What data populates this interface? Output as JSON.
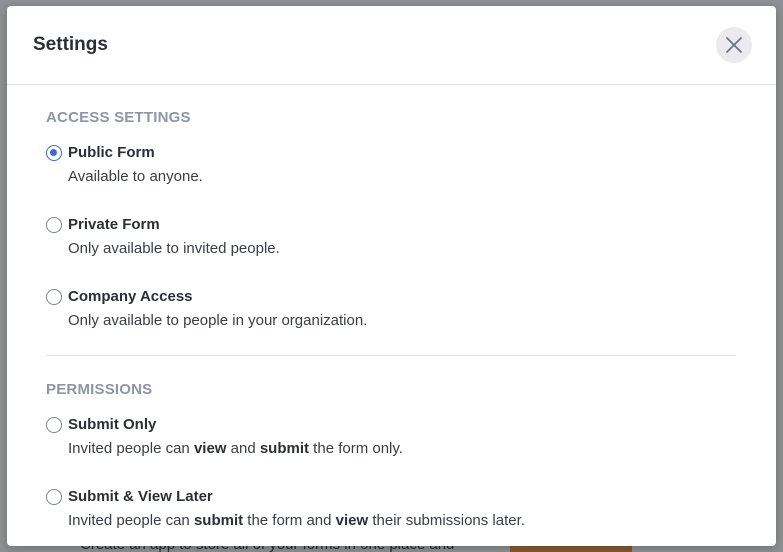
{
  "background": {
    "text": "Create an app to store all of your forms in one place and"
  },
  "dialog": {
    "title": "Settings",
    "close_icon": "close-icon"
  },
  "access": {
    "label": "ACCESS SETTINGS",
    "options": [
      {
        "title": "Public Form",
        "desc": "Available to anyone.",
        "selected": true
      },
      {
        "title": "Private Form",
        "desc": "Only available to invited people.",
        "selected": false
      },
      {
        "title": "Company Access",
        "desc": "Only available to people in your organization.",
        "selected": false
      }
    ]
  },
  "permissions": {
    "label": "PERMISSIONS",
    "options": [
      {
        "title": "Submit Only",
        "desc": {
          "p1": "Invited people can ",
          "b1": "view",
          "p2": " and ",
          "b2": "submit",
          "p3": " the form only."
        },
        "selected": false
      },
      {
        "title": "Submit & View Later",
        "desc": {
          "p1": "Invited people can ",
          "b1": "submit",
          "p2": " the form and ",
          "b2": "view",
          "p3": " their submissions later."
        },
        "selected": false
      }
    ]
  },
  "colors": {
    "accent": "#3b69d8",
    "section_label": "#8e95a8",
    "text": "#2c2f36"
  }
}
